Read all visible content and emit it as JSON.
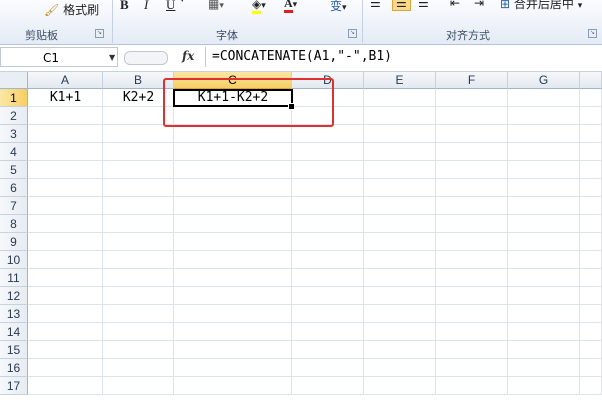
{
  "ribbon": {
    "format_painter_label": "格式刷",
    "bold": "B",
    "italic": "I",
    "underline": "U",
    "font_color_letter": "A",
    "phonetic": "变",
    "merge_center_label": "合并后居中",
    "groups": {
      "clipboard": "剪贴板",
      "font": "字体",
      "alignment": "对齐方式"
    }
  },
  "formula_bar": {
    "name_box": "C1",
    "fx_label": "fx",
    "formula": "=CONCATENATE(A1,\"-\",B1)"
  },
  "sheet": {
    "columns": [
      "A",
      "B",
      "C",
      "D",
      "E",
      "F",
      "G"
    ],
    "rows": [
      "1",
      "2",
      "3",
      "4",
      "5",
      "6",
      "7",
      "8",
      "9",
      "10",
      "11",
      "12",
      "13",
      "14",
      "15",
      "16",
      "17"
    ],
    "selected_column": "C",
    "selected_row": "1",
    "cells": {
      "A1": "K1+1",
      "B1": "K2+2",
      "C1": "K1+1-K2+2"
    }
  },
  "colors": {
    "highlight_box": "#e03030",
    "selected_header": "#f6cf62"
  }
}
